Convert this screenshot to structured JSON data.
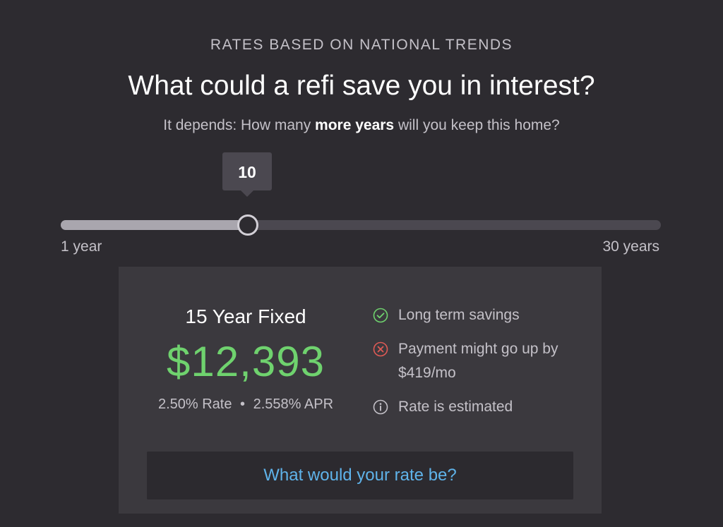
{
  "header": {
    "eyebrow": "RATES BASED ON NATIONAL TRENDS",
    "title": "What could a refi save you in interest?",
    "subtitle_prefix": "It depends: How many ",
    "subtitle_bold": "more years",
    "subtitle_suffix": " will you keep this home?"
  },
  "slider": {
    "value": 10,
    "value_label": "10",
    "min": 1,
    "max": 30,
    "min_label": "1 year",
    "max_label": "30 years",
    "fill_color": "#a9a6ae",
    "track_color": "#4b4850"
  },
  "result": {
    "product": "15 Year Fixed",
    "savings": "$12,393",
    "savings_color": "#6fd26e",
    "rate": "2.50% Rate",
    "separator": "•",
    "apr": "2.558% APR"
  },
  "features": [
    {
      "icon": "check-circle-icon",
      "text": "Long term savings",
      "color": "#6fd26e"
    },
    {
      "icon": "x-circle-icon",
      "text": "Payment might go up by $419/mo",
      "color": "#e05a55"
    },
    {
      "icon": "info-circle-icon",
      "text": "Rate is estimated",
      "color": "#c4c1c8"
    }
  ],
  "cta": {
    "label": "What would your rate be?",
    "color": "#5fb3ea"
  }
}
